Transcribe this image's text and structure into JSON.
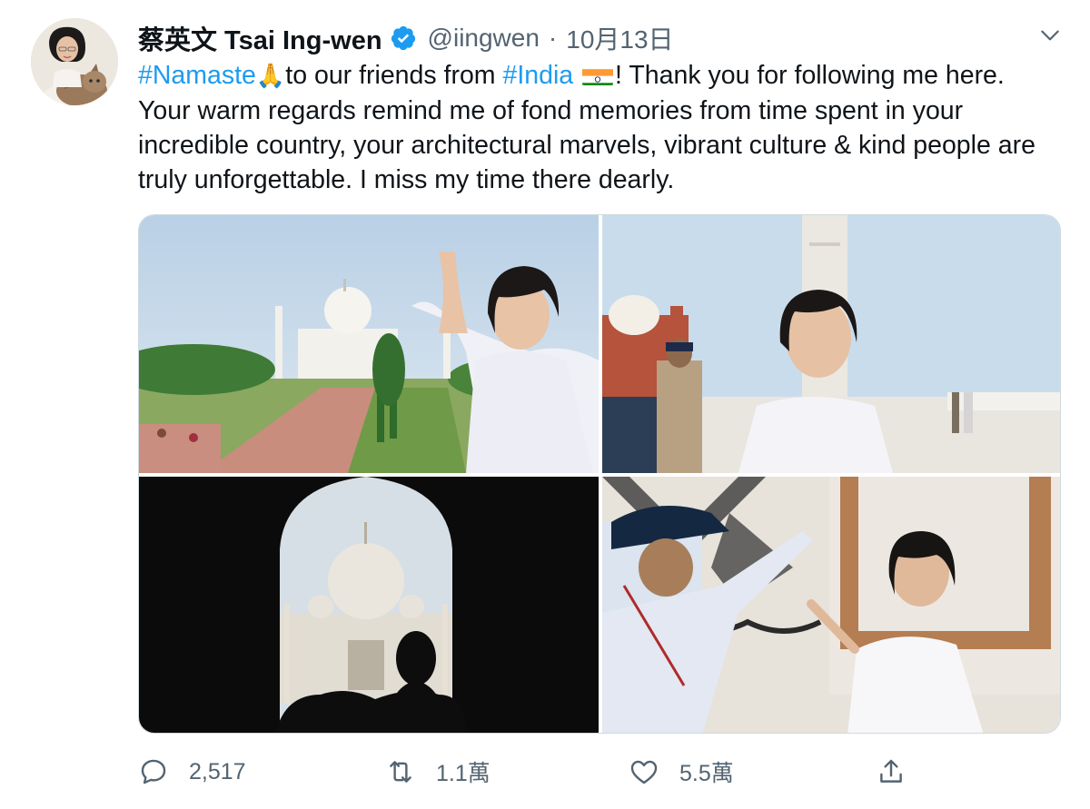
{
  "author": {
    "display_name": "蔡英文 Tsai Ing-wen",
    "handle": "@iingwen",
    "separator": "·",
    "date": "10月13日",
    "verified": true,
    "avatar_icon": "profile-photo-with-cat"
  },
  "tweet": {
    "hashtag_1": "#Namaste",
    "emoji_1": "🙏",
    "text_1": "to our friends from ",
    "hashtag_2": "#India",
    "text_2": "! Thank you for following me here. Your warm regards remind me of fond memories from time spent in your incredible country, your architectural marvels, vibrant culture & kind people are truly unforgettable. I miss my time there dearly.",
    "flag_icon": "india-flag"
  },
  "media": {
    "count": 4,
    "photos": [
      "photo-taj-mahal-pose",
      "photo-taj-mahal-courtyard",
      "photo-taj-mahal-arch-silhouette",
      "photo-marble-inlay-wall"
    ]
  },
  "actions": {
    "reply_count": "2,517",
    "retweet_count": "1.1萬",
    "like_count": "5.5萬",
    "share_label": ""
  },
  "colors": {
    "accent": "#1d9bf0",
    "text": "#0f1419",
    "secondary": "#536471",
    "border": "#cfd9de"
  }
}
